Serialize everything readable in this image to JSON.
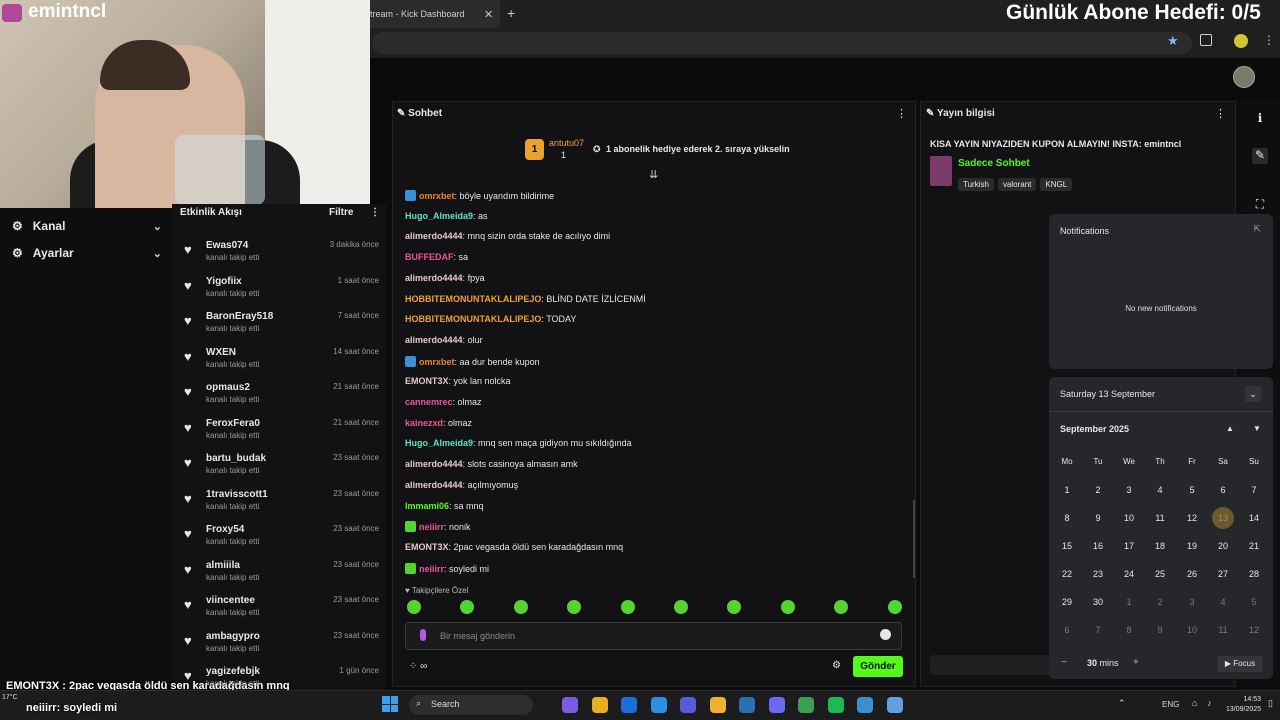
{
  "browser": {
    "tab_title": "tream - Kick Dashboard",
    "tab_close": "✕",
    "new_tab": "+"
  },
  "overlay": {
    "goal_text": "Günlük Abone Hedefi: 0/5",
    "cam_name": "emintncl",
    "caption_line1": "EMONT3X : 2pac vegasda öldü sen karadağdasın mnq",
    "caption_line2": "neiiirr: soyledi mi",
    "weather": "17°C"
  },
  "leftnav": {
    "items": [
      {
        "label": "Kanal",
        "icon": "channel-icon"
      },
      {
        "label": "Ayarlar",
        "icon": "gear-icon"
      }
    ]
  },
  "feed": {
    "title": "Etkinlik Akışı",
    "filter": "Filtre",
    "subtitle_label": "kanalı takip etti",
    "items": [
      {
        "name": "Ewas074",
        "time": "3 dakika önce"
      },
      {
        "name": "Yigofiix",
        "time": "1 saat önce"
      },
      {
        "name": "BaronEray518",
        "time": "7 saat önce"
      },
      {
        "name": "WXEN",
        "time": "14 saat önce"
      },
      {
        "name": "opmaus2",
        "time": "21 saat önce"
      },
      {
        "name": "FeroxFera0",
        "time": "21 saat önce"
      },
      {
        "name": "bartu_budak",
        "time": "23 saat önce"
      },
      {
        "name": "1travisscott1",
        "time": "23 saat önce"
      },
      {
        "name": "Froxy54",
        "time": "23 saat önce"
      },
      {
        "name": "almiiila",
        "time": "23 saat önce"
      },
      {
        "name": "viincentee",
        "time": "23 saat önce"
      },
      {
        "name": "ambagypro",
        "time": "23 saat önce"
      },
      {
        "name": "yagizefebjk",
        "time": "1 gün önce"
      }
    ]
  },
  "chat": {
    "title": "Sohbet",
    "top_gifter": "antutu07",
    "top_gifter_count": "1",
    "gift_prompt": "1 abonelik hediye ederek 2. sıraya yükselin",
    "messages": [
      {
        "user": "omrxbet",
        "text": "böyle uyandım bildirime",
        "color": "#e8872a",
        "badge": "#3a8fd8"
      },
      {
        "user": "Hugo_Almeida9",
        "text": "as",
        "color": "#5ee1c6",
        "badge": ""
      },
      {
        "user": "alimerdo4444",
        "text": "mnq sizin orda stake de acılıyo dimi",
        "color": "#e3c9c9",
        "badge": ""
      },
      {
        "user": "BUFFEDAF",
        "text": "sa",
        "color": "#e7559a",
        "badge": ""
      },
      {
        "user": "alimerdo4444",
        "text": "fpya",
        "color": "#e3c9c9",
        "badge": ""
      },
      {
        "user": "HOBBITEMONUNTAKLALIPEJO",
        "text": "BLİND DATE İZLİCENMİ",
        "color": "#f0a12c",
        "badge": ""
      },
      {
        "user": "HOBBITEMONUNTAKLALIPEJO",
        "text": "TODAY",
        "color": "#f0a12c",
        "badge": ""
      },
      {
        "user": "alimerdo4444",
        "text": "olur",
        "color": "#e3c9c9",
        "badge": ""
      },
      {
        "user": "omrxbet",
        "text": "aa dur bende kupon",
        "color": "#e8872a",
        "badge": "#3a8fd8"
      },
      {
        "user": "EMONT3X",
        "text": "yok lan nolcka",
        "color": "#e3c9c9",
        "badge": ""
      },
      {
        "user": "cannemrec",
        "text": "olmaz",
        "color": "#e7559a",
        "badge": ""
      },
      {
        "user": "kainezxd",
        "text": "olmaz",
        "color": "#e7559a",
        "badge": ""
      },
      {
        "user": "Hugo_Almeida9",
        "text": "mnq sen maça gidiyon mu sıkıldığında",
        "color": "#5ee1c6",
        "badge": ""
      },
      {
        "user": "alimerdo4444",
        "text": "slots casinoya almasın amk",
        "color": "#e3c9c9",
        "badge": ""
      },
      {
        "user": "alimerdo4444",
        "text": "açılmıyomuş",
        "color": "#e3c9c9",
        "badge": ""
      },
      {
        "user": "lmmami06",
        "text": "sa mnq",
        "color": "#53fc18",
        "badge": ""
      },
      {
        "user": "neiiirr",
        "text": "nonik",
        "color": "#e7559a",
        "badge": "#53d42f"
      },
      {
        "user": "EMONT3X",
        "text": "2pac vegasda öldü sen karadağdasın mnq",
        "color": "#e3c9c9",
        "badge": ""
      },
      {
        "user": "neiiirr",
        "text": "soyledi mi",
        "color": "#e7559a",
        "badge": "#53d42f"
      }
    ],
    "emote_section": "Takipçilere Özel",
    "input_placeholder": "Bir mesaj gönderin",
    "send_label": "Gönder"
  },
  "info": {
    "title": "Yayın bilgisi",
    "stream_title": "KISA YAYIN NIYAZIDEN KUPON ALMAYIN! INSTA: emintncl",
    "category": "Sadece Sohbet",
    "tags": [
      "Turkish",
      "valorant",
      "KNGL"
    ]
  },
  "notifications": {
    "title": "Notifications",
    "empty": "No new notifications"
  },
  "calendar": {
    "date_header": "Saturday 13 September",
    "month": "September 2025",
    "weekdays": [
      "Mo",
      "Tu",
      "We",
      "Th",
      "Fr",
      "Sa",
      "Su"
    ],
    "weeks": [
      [
        "1",
        "2",
        "3",
        "4",
        "5",
        "6",
        "7"
      ],
      [
        "8",
        "9",
        "10",
        "11",
        "12",
        "13",
        "14"
      ],
      [
        "15",
        "16",
        "17",
        "18",
        "19",
        "20",
        "21"
      ],
      [
        "22",
        "23",
        "24",
        "25",
        "26",
        "27",
        "28"
      ],
      [
        "29",
        "30",
        "1",
        "2",
        "3",
        "4",
        "5"
      ],
      [
        "6",
        "7",
        "8",
        "9",
        "10",
        "11",
        "12"
      ]
    ],
    "focus_minutes": "30",
    "focus_unit": "mins",
    "focus_label": "Focus",
    "today": "13"
  },
  "taskbar": {
    "search": "Search",
    "lang": "ENG",
    "time": "14:53",
    "date": "13/09/2025"
  },
  "colors": {
    "kick_green": "#53fc18",
    "panel": "#121214"
  }
}
